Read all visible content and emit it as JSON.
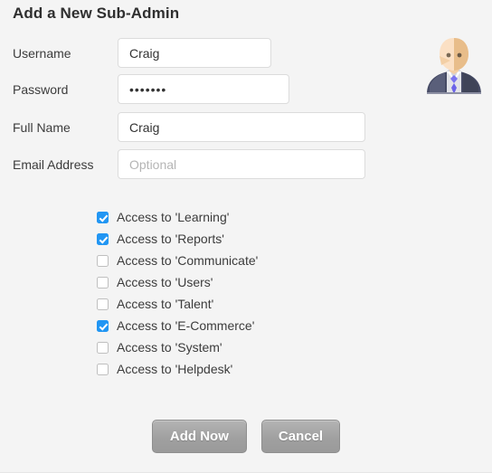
{
  "header": {
    "title": "Add a New Sub-Admin"
  },
  "avatar": {
    "icon": "user-avatar-businessman-icon",
    "colors": {
      "face_light": "#fbe0c4",
      "face_dark": "#e8bd8a",
      "suit": "#464b65",
      "suit_shade": "#5a5f7a",
      "shirt": "#e2e3e8",
      "tie": "#6b63e8",
      "eye": "#7a6a56"
    }
  },
  "form": {
    "fields": [
      {
        "name": "username",
        "label": "Username",
        "value": "Craig",
        "placeholder": "",
        "type": "text"
      },
      {
        "name": "password",
        "label": "Password",
        "value": "•••••••",
        "placeholder": "",
        "type": "password"
      },
      {
        "name": "fullname",
        "label": "Full Name",
        "value": "Craig",
        "placeholder": "",
        "type": "text"
      },
      {
        "name": "email",
        "label": "Email Address",
        "value": "",
        "placeholder": "Optional",
        "type": "email"
      }
    ]
  },
  "permissions": {
    "items": [
      {
        "label": "Access to 'Learning'",
        "checked": true
      },
      {
        "label": "Access to 'Reports'",
        "checked": true
      },
      {
        "label": "Access to 'Communicate'",
        "checked": false
      },
      {
        "label": "Access to 'Users'",
        "checked": false
      },
      {
        "label": "Access to 'Talent'",
        "checked": false
      },
      {
        "label": "Access to 'E-Commerce'",
        "checked": true
      },
      {
        "label": "Access to 'System'",
        "checked": false
      },
      {
        "label": "Access to 'Helpdesk'",
        "checked": false
      }
    ]
  },
  "buttons": {
    "submit_label": "Add Now",
    "cancel_label": "Cancel"
  },
  "colors": {
    "background": "#f4f4f4",
    "checkbox_accent": "#2196f3",
    "button_face": "#a0a0a0",
    "input_border": "#dcdcdc",
    "text": "#3c3c3c"
  }
}
